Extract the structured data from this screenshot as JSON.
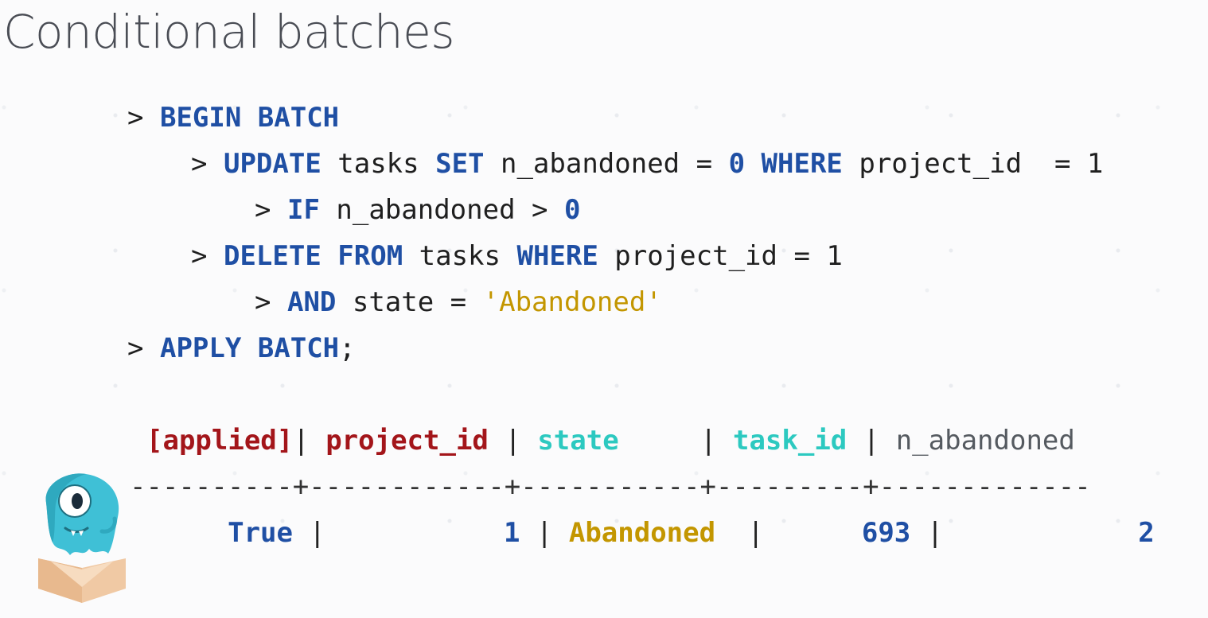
{
  "slide": {
    "title": "Conditional batches"
  },
  "code": {
    "prompt": ">",
    "line1": {
      "kw": "BEGIN BATCH"
    },
    "line2": {
      "kw1": "UPDATE",
      "t1": " tasks ",
      "kw2": "SET",
      "t2": " n_abandoned = ",
      "n1": "0",
      "t3": " ",
      "kw3": "WHERE",
      "t4": " project_id  = 1"
    },
    "line3": {
      "kw1": "IF",
      "t1": " n_abandoned > ",
      "n1": "0"
    },
    "line4": {
      "kw1": "DELETE",
      "t1": " ",
      "kw2": "FROM",
      "t2": " tasks ",
      "kw3": "WHERE",
      "t3": " project_id = 1"
    },
    "line5": {
      "kw1": "AND",
      "t1": " state = ",
      "s1": "'Abandoned'"
    },
    "line6": {
      "kw": "APPLY BATCH",
      "t1": ";"
    }
  },
  "result_table": {
    "headers": [
      "[applied]",
      "project_id",
      "state",
      "task_id",
      "n_abandoned"
    ],
    "separator": "----------+------------+-----------+---------+-------------",
    "row": [
      "True",
      "1",
      "Abandoned",
      "693",
      "2"
    ]
  },
  "colors": {
    "keyword": "#1f4fa4",
    "string": "#c39600",
    "header_red": "#a3151a",
    "header_cyan": "#2cc9c0",
    "mascot_teal": "#3fc0d6"
  },
  "icons": {
    "mascot": "scylla-monster-icon"
  }
}
